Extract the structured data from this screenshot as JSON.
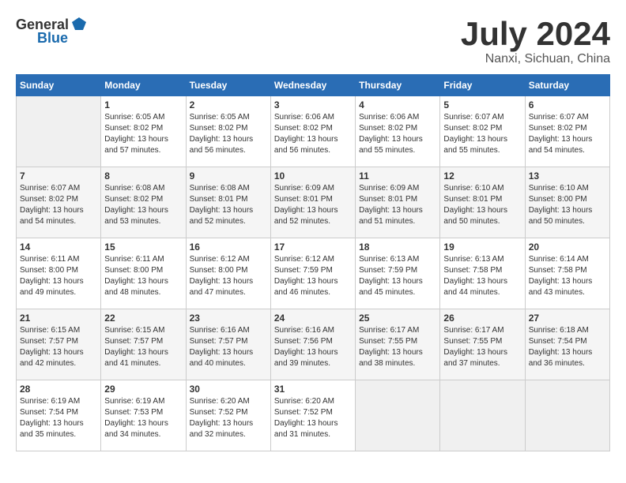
{
  "header": {
    "logo_general": "General",
    "logo_blue": "Blue",
    "month": "July 2024",
    "location": "Nanxi, Sichuan, China"
  },
  "weekdays": [
    "Sunday",
    "Monday",
    "Tuesday",
    "Wednesday",
    "Thursday",
    "Friday",
    "Saturday"
  ],
  "weeks": [
    [
      {
        "day": null
      },
      {
        "day": "1",
        "sunrise": "6:05 AM",
        "sunset": "8:02 PM",
        "daylight": "13 hours and 57 minutes."
      },
      {
        "day": "2",
        "sunrise": "6:05 AM",
        "sunset": "8:02 PM",
        "daylight": "13 hours and 56 minutes."
      },
      {
        "day": "3",
        "sunrise": "6:06 AM",
        "sunset": "8:02 PM",
        "daylight": "13 hours and 56 minutes."
      },
      {
        "day": "4",
        "sunrise": "6:06 AM",
        "sunset": "8:02 PM",
        "daylight": "13 hours and 55 minutes."
      },
      {
        "day": "5",
        "sunrise": "6:07 AM",
        "sunset": "8:02 PM",
        "daylight": "13 hours and 55 minutes."
      },
      {
        "day": "6",
        "sunrise": "6:07 AM",
        "sunset": "8:02 PM",
        "daylight": "13 hours and 54 minutes."
      }
    ],
    [
      {
        "day": "7",
        "sunrise": "6:07 AM",
        "sunset": "8:02 PM",
        "daylight": "13 hours and 54 minutes."
      },
      {
        "day": "8",
        "sunrise": "6:08 AM",
        "sunset": "8:02 PM",
        "daylight": "13 hours and 53 minutes."
      },
      {
        "day": "9",
        "sunrise": "6:08 AM",
        "sunset": "8:01 PM",
        "daylight": "13 hours and 52 minutes."
      },
      {
        "day": "10",
        "sunrise": "6:09 AM",
        "sunset": "8:01 PM",
        "daylight": "13 hours and 52 minutes."
      },
      {
        "day": "11",
        "sunrise": "6:09 AM",
        "sunset": "8:01 PM",
        "daylight": "13 hours and 51 minutes."
      },
      {
        "day": "12",
        "sunrise": "6:10 AM",
        "sunset": "8:01 PM",
        "daylight": "13 hours and 50 minutes."
      },
      {
        "day": "13",
        "sunrise": "6:10 AM",
        "sunset": "8:00 PM",
        "daylight": "13 hours and 50 minutes."
      }
    ],
    [
      {
        "day": "14",
        "sunrise": "6:11 AM",
        "sunset": "8:00 PM",
        "daylight": "13 hours and 49 minutes."
      },
      {
        "day": "15",
        "sunrise": "6:11 AM",
        "sunset": "8:00 PM",
        "daylight": "13 hours and 48 minutes."
      },
      {
        "day": "16",
        "sunrise": "6:12 AM",
        "sunset": "8:00 PM",
        "daylight": "13 hours and 47 minutes."
      },
      {
        "day": "17",
        "sunrise": "6:12 AM",
        "sunset": "7:59 PM",
        "daylight": "13 hours and 46 minutes."
      },
      {
        "day": "18",
        "sunrise": "6:13 AM",
        "sunset": "7:59 PM",
        "daylight": "13 hours and 45 minutes."
      },
      {
        "day": "19",
        "sunrise": "6:13 AM",
        "sunset": "7:58 PM",
        "daylight": "13 hours and 44 minutes."
      },
      {
        "day": "20",
        "sunrise": "6:14 AM",
        "sunset": "7:58 PM",
        "daylight": "13 hours and 43 minutes."
      }
    ],
    [
      {
        "day": "21",
        "sunrise": "6:15 AM",
        "sunset": "7:57 PM",
        "daylight": "13 hours and 42 minutes."
      },
      {
        "day": "22",
        "sunrise": "6:15 AM",
        "sunset": "7:57 PM",
        "daylight": "13 hours and 41 minutes."
      },
      {
        "day": "23",
        "sunrise": "6:16 AM",
        "sunset": "7:57 PM",
        "daylight": "13 hours and 40 minutes."
      },
      {
        "day": "24",
        "sunrise": "6:16 AM",
        "sunset": "7:56 PM",
        "daylight": "13 hours and 39 minutes."
      },
      {
        "day": "25",
        "sunrise": "6:17 AM",
        "sunset": "7:55 PM",
        "daylight": "13 hours and 38 minutes."
      },
      {
        "day": "26",
        "sunrise": "6:17 AM",
        "sunset": "7:55 PM",
        "daylight": "13 hours and 37 minutes."
      },
      {
        "day": "27",
        "sunrise": "6:18 AM",
        "sunset": "7:54 PM",
        "daylight": "13 hours and 36 minutes."
      }
    ],
    [
      {
        "day": "28",
        "sunrise": "6:19 AM",
        "sunset": "7:54 PM",
        "daylight": "13 hours and 35 minutes."
      },
      {
        "day": "29",
        "sunrise": "6:19 AM",
        "sunset": "7:53 PM",
        "daylight": "13 hours and 34 minutes."
      },
      {
        "day": "30",
        "sunrise": "6:20 AM",
        "sunset": "7:52 PM",
        "daylight": "13 hours and 32 minutes."
      },
      {
        "day": "31",
        "sunrise": "6:20 AM",
        "sunset": "7:52 PM",
        "daylight": "13 hours and 31 minutes."
      },
      {
        "day": null
      },
      {
        "day": null
      },
      {
        "day": null
      }
    ]
  ]
}
